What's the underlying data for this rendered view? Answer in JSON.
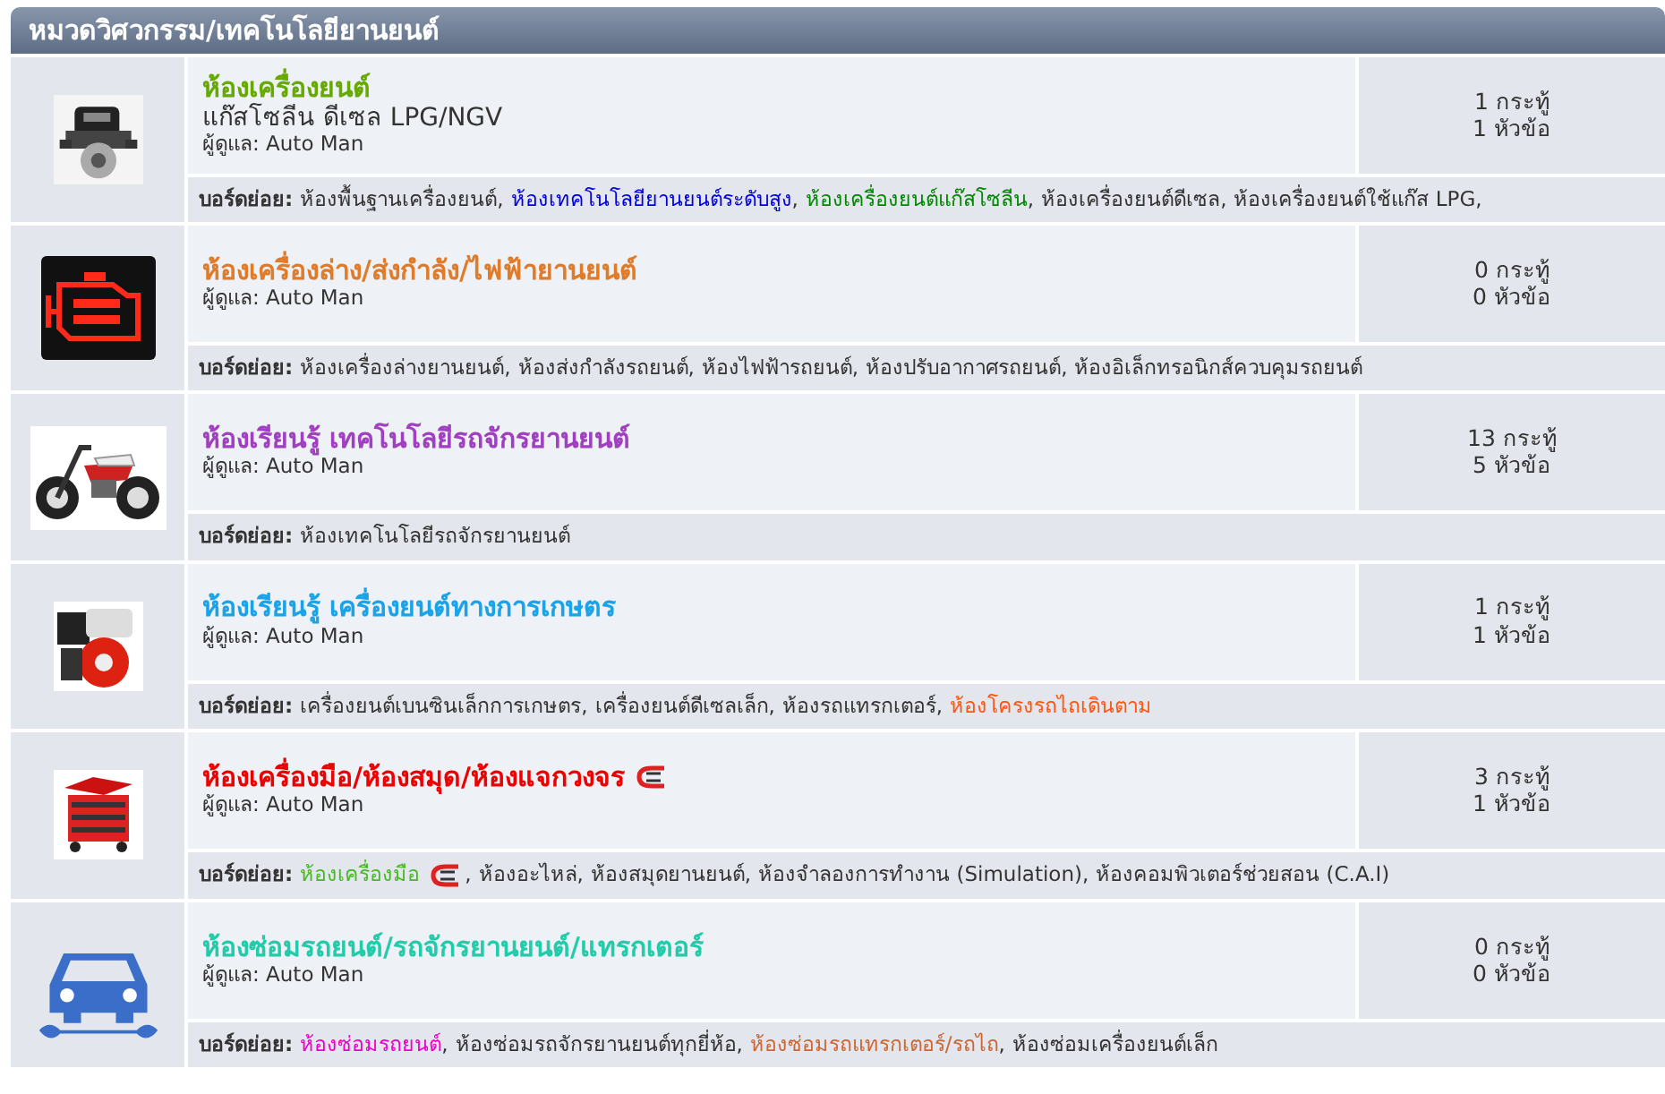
{
  "category": {
    "title": "หมวดวิศวกรรม/เทคโนโลยียานยนต์"
  },
  "forums": [
    {
      "kind": "engine",
      "title": "ห้องเครื่องยนต์",
      "color": "#66aa00",
      "title_icon": false,
      "subtitle": "แก๊สโซลีน ดีเซล LPG/NGV",
      "moderator": "ผู้ดูแล: Auto Man",
      "posts": "1 กระทู้",
      "topics": "1 หัวข้อ",
      "subforums": {
        "label": "บอร์ดย่อย:",
        "separator": ",",
        "items": [
          {
            "text": "ห้องพื้นฐานเครื่องยนต์",
            "color": "#333333",
            "icon": false
          },
          {
            "text": "ห้องเทคโนโลยียานยนต์ระดับสูง",
            "color": "#0000dd",
            "icon": false
          },
          {
            "text": "ห้องเครื่องยนต์แก๊สโซลีน",
            "color": "#008800",
            "icon": false
          },
          {
            "text": "ห้องเครื่องยนต์ดีเซล",
            "color": "#333333",
            "icon": false
          },
          {
            "text": "ห้องเครื่องยนต์ใช้แก๊ส LPG,",
            "color": "#333333",
            "icon": false
          }
        ]
      }
    },
    {
      "kind": "warning-light",
      "title": "ห้องเครื่องล่าง/ส่งกำลัง/ไฟฟ้ายานยนต์",
      "color": "#e07b2a",
      "title_icon": false,
      "moderator": "ผู้ดูแล: Auto Man",
      "posts": "0 กระทู้",
      "topics": "0 หัวข้อ",
      "subforums": {
        "label": "บอร์ดย่อย:",
        "separator": ",",
        "items": [
          {
            "text": "ห้องเครื่องล่างยานยนต์",
            "color": "#333333",
            "icon": false
          },
          {
            "text": "ห้องส่งกำลังรถยนต์",
            "color": "#333333",
            "icon": false
          },
          {
            "text": "ห้องไฟฟ้ารถยนต์",
            "color": "#333333",
            "icon": false
          },
          {
            "text": "ห้องปรับอากาศรถยนต์",
            "color": "#333333",
            "icon": false
          },
          {
            "text": "ห้องอิเล็กทรอนิกส์ควบคุมรถยนต์",
            "color": "#333333",
            "icon": false
          }
        ]
      }
    },
    {
      "kind": "motorcycle",
      "title": "ห้องเรียนรู้ เทคโนโลยีรถจักรยานยนต์",
      "color": "#a040c0",
      "title_icon": false,
      "moderator": "ผู้ดูแล: Auto Man",
      "posts": "13 กระทู้",
      "topics": "5 หัวข้อ",
      "subforums": {
        "label": "บอร์ดย่อย:",
        "items": [
          {
            "text": "ห้องเทคโนโลยีรถจักรยานยนต์",
            "color": "#333333",
            "icon": false
          }
        ]
      }
    },
    {
      "kind": "small-engine",
      "title": "ห้องเรียนรู้ เครื่องยนต์ทางการเกษตร",
      "color": "#1aa3e8",
      "title_icon": false,
      "moderator": "ผู้ดูแล: Auto Man",
      "posts": "1 กระทู้",
      "topics": "1 หัวข้อ",
      "subforums": {
        "label": "บอร์ดย่อย:",
        "separator": ",",
        "items": [
          {
            "text": "เครื่องยนต์เบนซินเล็กการเกษตร",
            "color": "#333333",
            "icon": false
          },
          {
            "text": "เครื่องยนต์ดีเซลเล็ก",
            "color": "#333333",
            "icon": false
          },
          {
            "text": "ห้องรถแทรกเตอร์",
            "color": "#333333",
            "icon": false
          },
          {
            "text": "ห้องโครงรถไถเดินตาม",
            "color": "#ff5511",
            "icon": false
          }
        ]
      }
    },
    {
      "kind": "toolbox",
      "title": "ห้องเครื่องมือ/ห้องสมุด/ห้องแจกวงจร",
      "color": "#ee0000",
      "title_icon": true,
      "moderator": "ผู้ดูแล: Auto Man",
      "posts": "3 กระทู้",
      "topics": "1 หัวข้อ",
      "subforums": {
        "label": "บอร์ดย่อย:",
        "separator": ",",
        "items": [
          {
            "text": "ห้องเครื่องมือ",
            "color": "#44bb22",
            "icon": true
          },
          {
            "text": "ห้องอะไหล่",
            "color": "#333333",
            "icon": false
          },
          {
            "text": "ห้องสมุดยานยนต์",
            "color": "#333333",
            "icon": false
          },
          {
            "text": "ห้องจำลองการทำงาน (Simulation)",
            "color": "#333333",
            "icon": false
          },
          {
            "text": "ห้องคอมพิวเตอร์ช่วยสอน (C.A.I)",
            "color": "#333333",
            "icon": false
          }
        ]
      }
    },
    {
      "kind": "car-wrench",
      "title": "ห้องซ่อมรถยนต์/รถจักรยานยนต์/แทรกเตอร์",
      "color": "#22ccaa",
      "title_icon": false,
      "moderator": "ผู้ดูแล: Auto Man",
      "posts": "0 กระทู้",
      "topics": "0 หัวข้อ",
      "subforums": {
        "label": "บอร์ดย่อย:",
        "separator": ",",
        "items": [
          {
            "text": "ห้องซ่อมรถยนต์",
            "color": "#ee00cc",
            "icon": false
          },
          {
            "text": "ห้องซ่อมรถจักรยานยนต์ทุกยี่ห้อ",
            "color": "#333333",
            "icon": false
          },
          {
            "text": "ห้องซ่อมรถแทรกเตอร์/รถไถ",
            "color": "#cc6633",
            "icon": false
          },
          {
            "text": "ห้องซ่อมเครื่องยนต์เล็ก",
            "color": "#333333",
            "icon": false
          }
        ]
      }
    }
  ]
}
